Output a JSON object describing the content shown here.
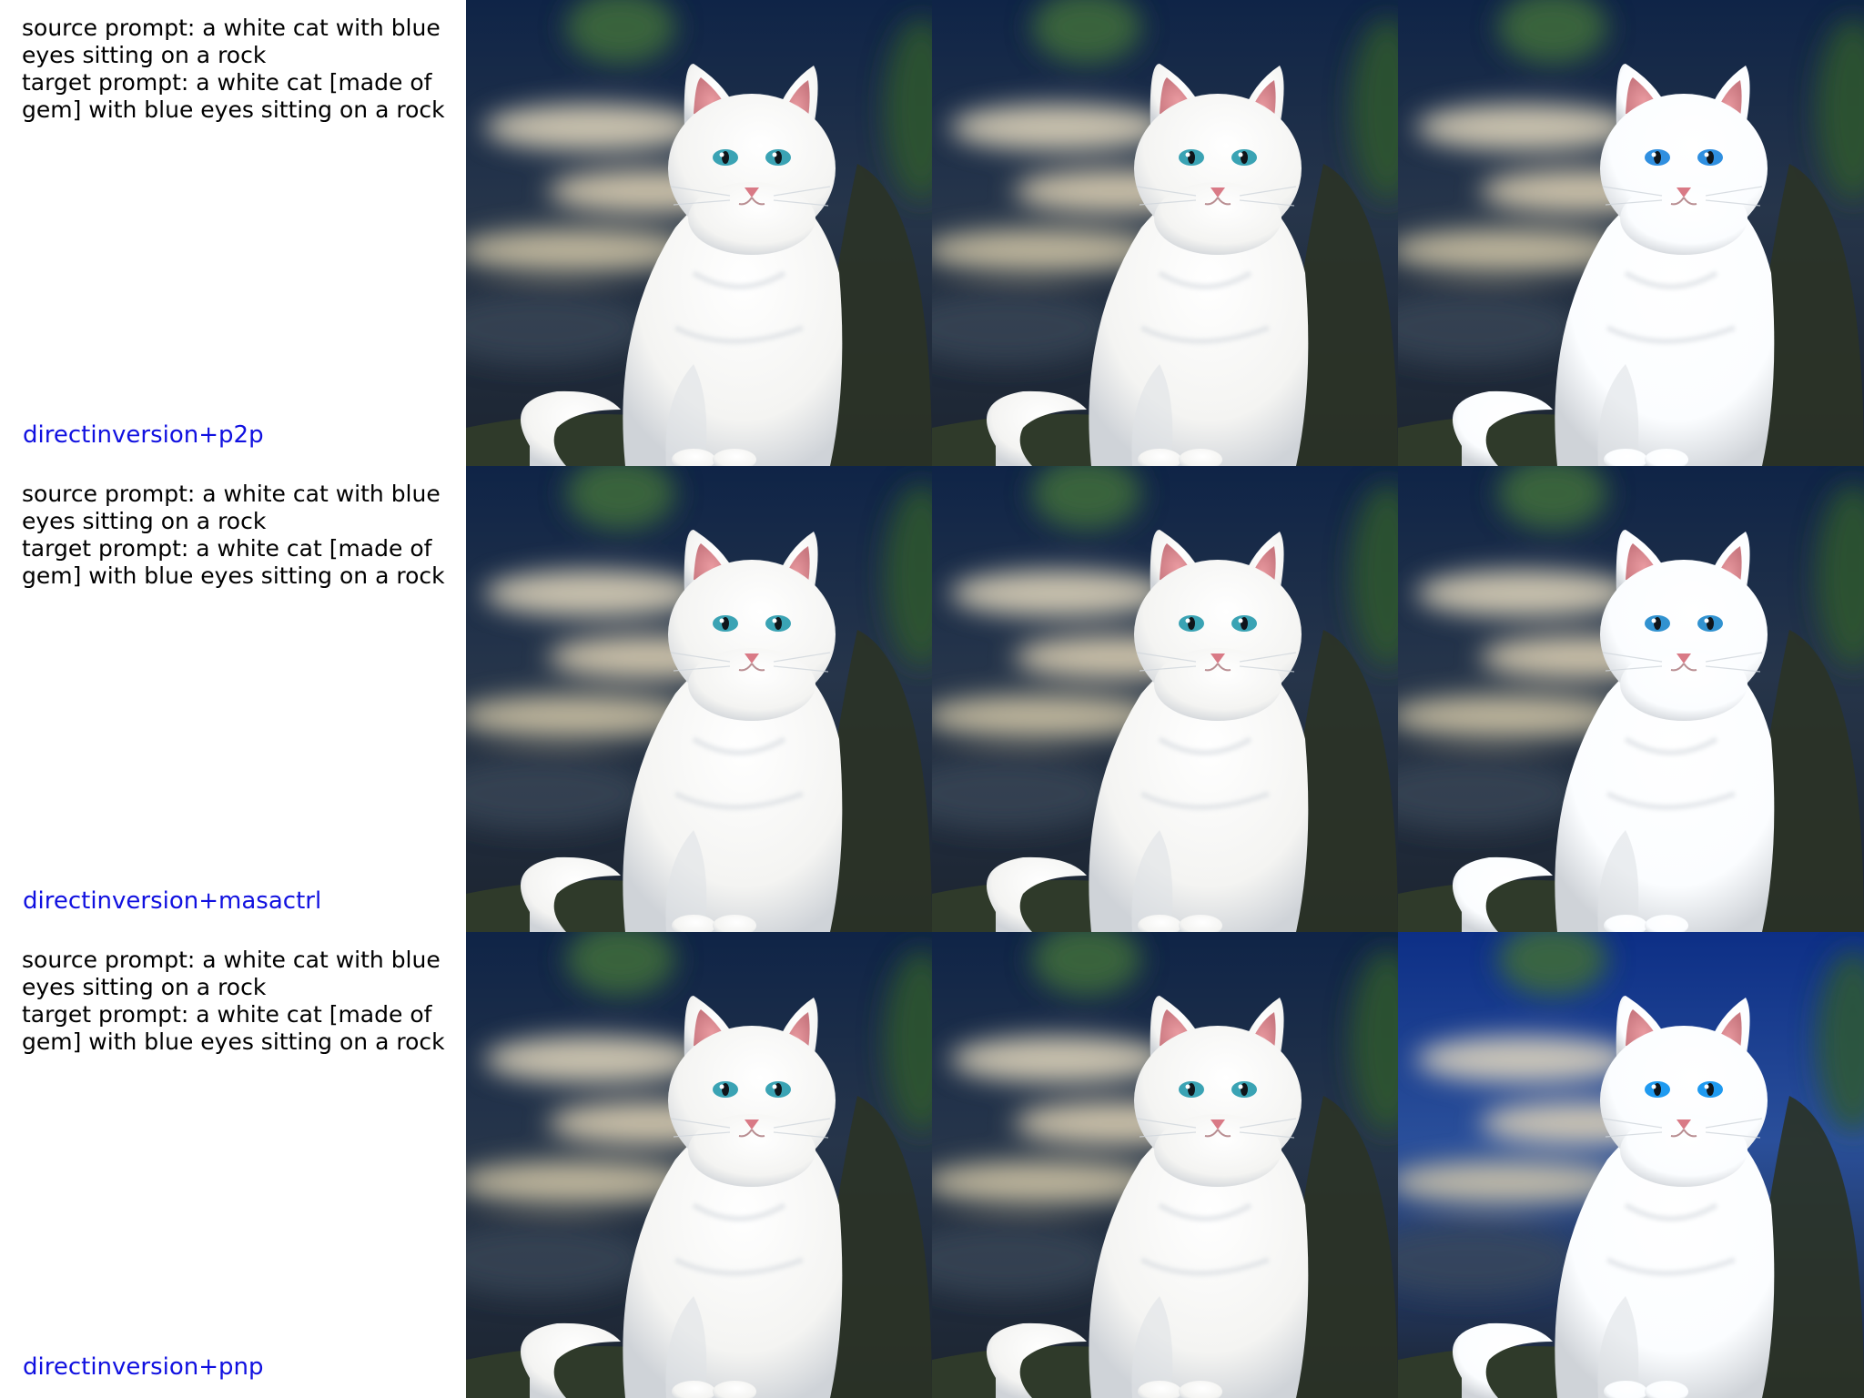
{
  "colors": {
    "method_label": "#1010e0",
    "prompt_text": "#000000",
    "background": "#ffffff"
  },
  "rows": [
    {
      "source_prompt": "source prompt: a white cat with blue eyes sitting on a rock",
      "target_prompt": "target prompt: a white cat [made of gem] with blue eyes sitting on a rock",
      "method": "directinversion+p2p",
      "images": [
        {
          "description": "white cat with teal eyes sitting on a mossy rock, blurred night background",
          "eye_color": "#3aa3b4"
        },
        {
          "description": "white cat with teal eyes sitting on a mossy rock, blurred night background",
          "eye_color": "#3aa3b4"
        },
        {
          "description": "white cat with bright blue eyes, brighter white fur, blurred night background",
          "eye_color": "#2f8fe0"
        }
      ]
    },
    {
      "source_prompt": "source prompt: a white cat with blue eyes sitting on a rock",
      "target_prompt": "target prompt: a white cat [made of gem] with blue eyes sitting on a rock",
      "method": "directinversion+masactrl",
      "images": [
        {
          "description": "white cat with teal eyes sitting on a mossy rock, blurred night background",
          "eye_color": "#3aa3b4"
        },
        {
          "description": "white cat with teal eyes sitting on a mossy rock, blurred night background",
          "eye_color": "#3aa3b4"
        },
        {
          "description": "white cat with blue eyes, slightly hazier background",
          "eye_color": "#3192d0"
        }
      ]
    },
    {
      "source_prompt": "source prompt: a white cat with blue eyes sitting on a rock",
      "target_prompt": "target prompt: a white cat [made of gem] with blue eyes sitting on a rock",
      "method": "directinversion+pnp",
      "images": [
        {
          "description": "white cat with teal eyes sitting on a mossy rock, blurred night background",
          "eye_color": "#3aa3b4"
        },
        {
          "description": "white cat with teal eyes sitting on a mossy rock, blurred night background",
          "eye_color": "#3aa3b4"
        },
        {
          "description": "white cat with vivid blue eyes, deep blue background",
          "eye_color": "#1f9af0"
        }
      ]
    }
  ]
}
